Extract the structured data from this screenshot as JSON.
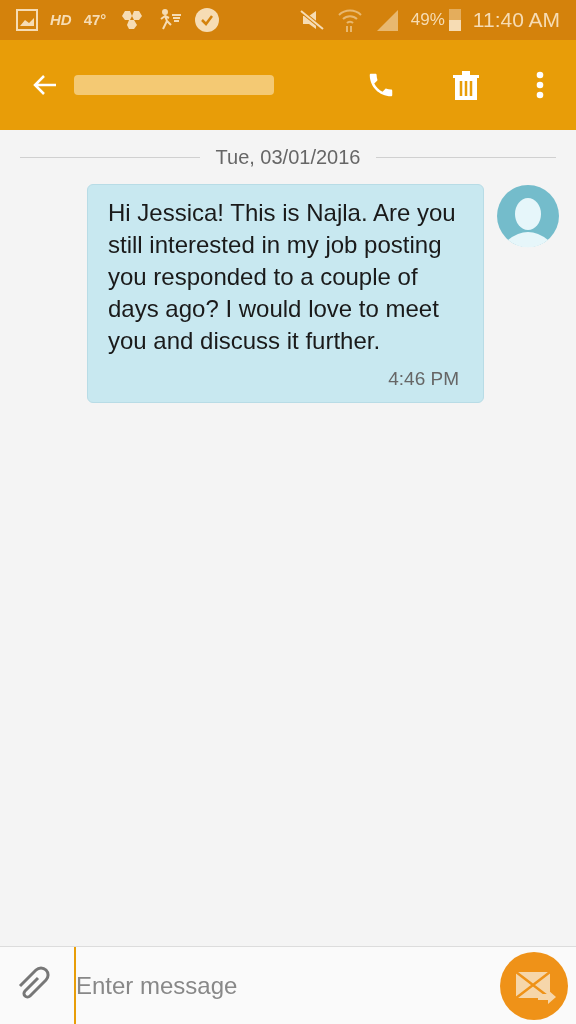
{
  "status_bar": {
    "hd": "HD",
    "temperature": "47°",
    "battery": "49%",
    "time": "11:40 AM"
  },
  "conversation": {
    "date": "Tue, 03/01/2016",
    "messages": [
      {
        "text": "Hi Jessica! This is Najla. Are you still interested in my job posting you responded to a couple of days ago? I would love to meet you and discuss it further.",
        "time": "4:46 PM"
      }
    ]
  },
  "composer": {
    "placeholder": "Enter message"
  }
}
